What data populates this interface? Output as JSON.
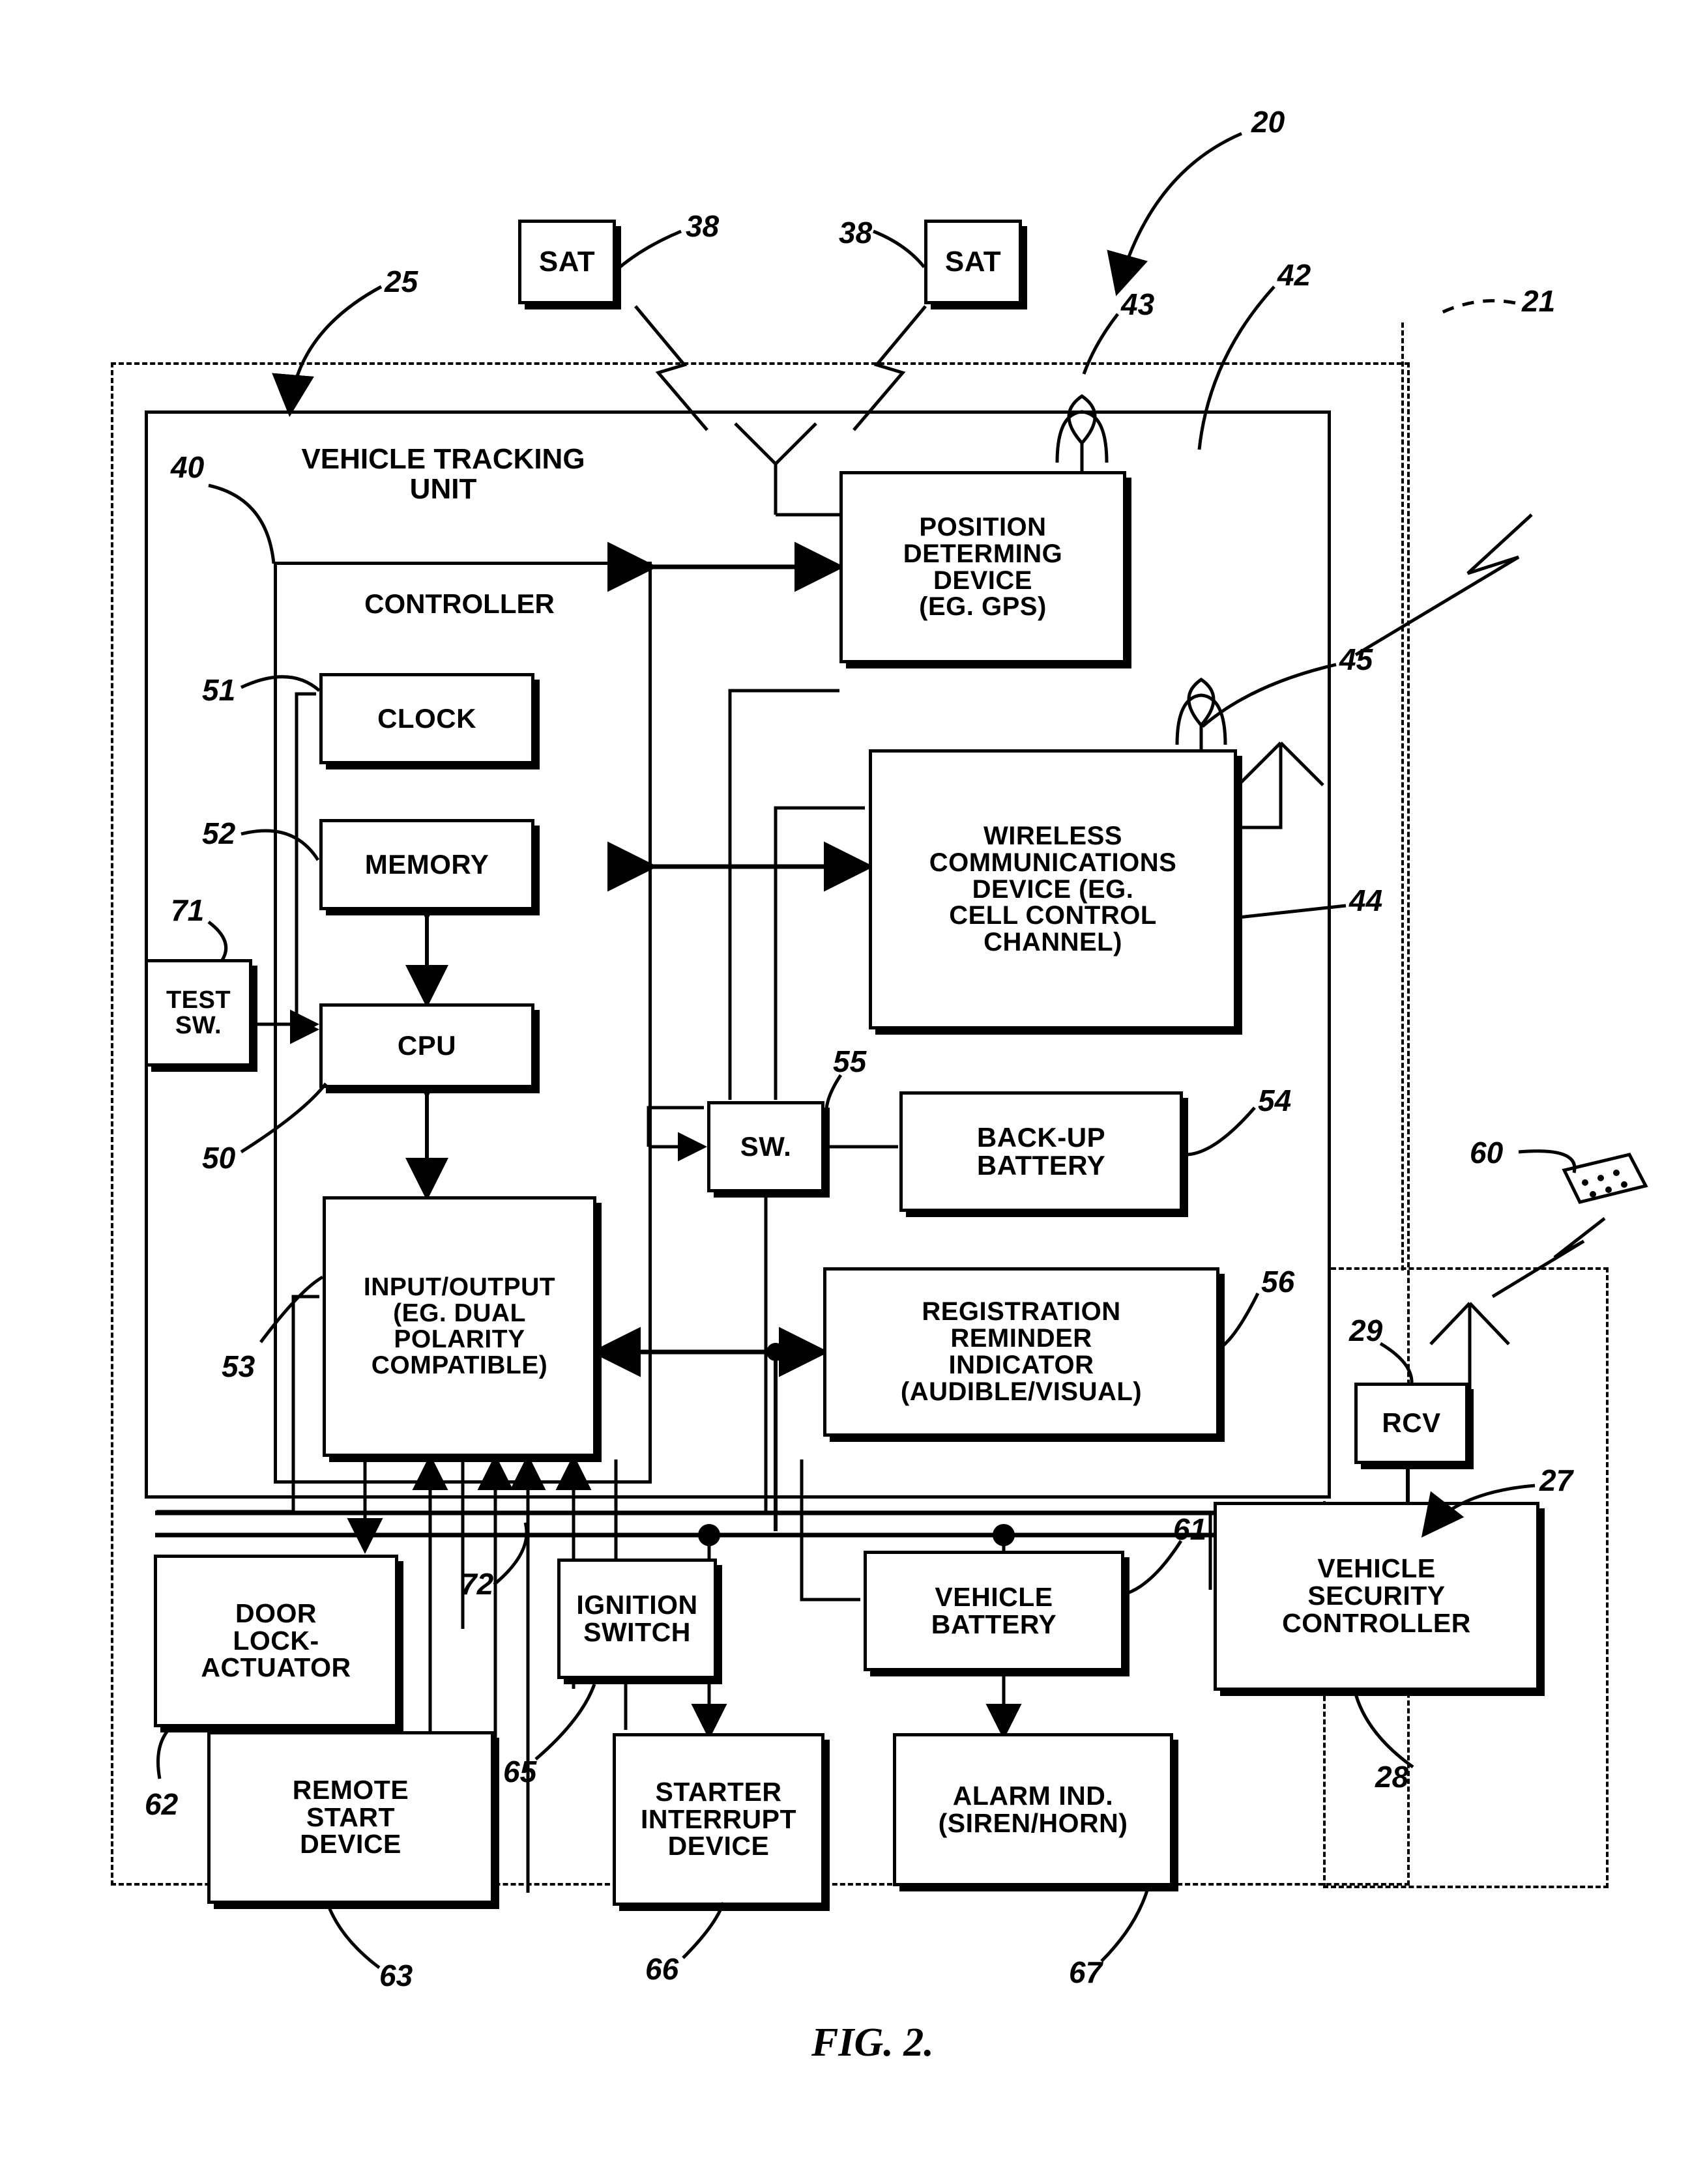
{
  "figure": {
    "label": "FIG. 2.",
    "title": "Vehicle tracking and security system block diagram"
  },
  "boxes": {
    "sat_left": {
      "label": "SAT"
    },
    "sat_right": {
      "label": "SAT"
    },
    "vehicle_tracking_unit": {
      "label": "VEHICLE TRACKING\nUNIT"
    },
    "controller": {
      "label": "CONTROLLER"
    },
    "clock": {
      "label": "CLOCK"
    },
    "memory": {
      "label": "MEMORY"
    },
    "cpu": {
      "label": "CPU"
    },
    "test_sw": {
      "label": "TEST\nSW."
    },
    "input_output": {
      "label": "INPUT/OUTPUT\n(EG. DUAL\nPOLARITY\nCOMPATIBLE)"
    },
    "position_determining": {
      "label": "POSITION\nDETERMING\nDEVICE\n(EG. GPS)"
    },
    "wireless_comms": {
      "label": "WIRELESS\nCOMMUNICATIONS\nDEVICE (EG.\nCELL CONTROL\nCHANNEL)"
    },
    "sw": {
      "label": "SW."
    },
    "backup_battery": {
      "label": "BACK-UP\nBATTERY"
    },
    "registration_reminder": {
      "label": "REGISTRATION\nREMINDER\nINDICATOR\n(AUDIBLE/VISUAL)"
    },
    "door_lock_actuator": {
      "label": "DOOR\nLOCK-\nACTUATOR"
    },
    "remote_start_device": {
      "label": "REMOTE\nSTART\nDEVICE"
    },
    "ignition_switch": {
      "label": "IGNITION\nSWITCH"
    },
    "starter_interrupt": {
      "label": "STARTER\nINTERRUPT\nDEVICE"
    },
    "alarm_indicator": {
      "label": "ALARM IND.\n(SIREN/HORN)"
    },
    "vehicle_battery": {
      "label": "VEHICLE\nBATTERY"
    },
    "rcv": {
      "label": "RCV"
    },
    "vehicle_security_controller": {
      "label": "VEHICLE\nSECURITY\nCONTROLLER"
    }
  },
  "reference_numerals": {
    "n20": "20",
    "n21": "21",
    "n25": "25",
    "n27": "27",
    "n28": "28",
    "n29": "29",
    "n38_left": "38",
    "n38_right": "38",
    "n40": "40",
    "n42": "42",
    "n43": "43",
    "n44": "44",
    "n45": "45",
    "n50": "50",
    "n51": "51",
    "n52": "52",
    "n53": "53",
    "n54": "54",
    "n55": "55",
    "n56": "56",
    "n60": "60",
    "n61": "61",
    "n62": "62",
    "n63": "63",
    "n65": "65",
    "n66": "66",
    "n67": "67",
    "n71": "71",
    "n72": "72"
  },
  "colors": {
    "ink": "#000000",
    "paper": "#ffffff"
  }
}
